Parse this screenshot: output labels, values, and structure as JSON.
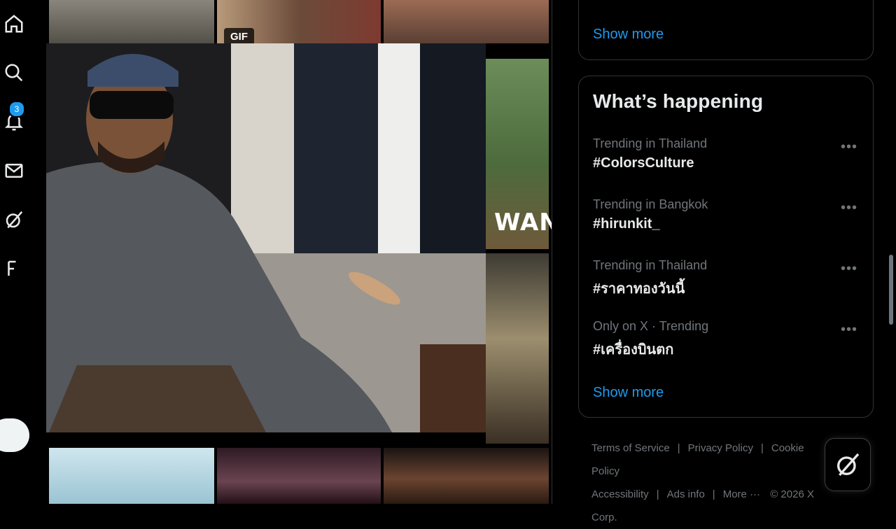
{
  "nav": {
    "notifications_badge": "3",
    "icons": [
      "home-icon",
      "search-icon",
      "bell-icon",
      "mail-icon",
      "grok-icon",
      "people-icon"
    ]
  },
  "grid": {
    "gif_badge": "GIF",
    "overlay_text": "WAN"
  },
  "sidebar": {
    "top_panel": {
      "show_more": "Show more"
    },
    "whats_happening": {
      "title": "What’s happening",
      "trends": [
        {
          "meta": "Trending in Thailand",
          "name": "#ColorsCulture"
        },
        {
          "meta": "Trending in Bangkok",
          "name": "#hirunkit_"
        },
        {
          "meta": "Trending in Thailand",
          "name": "#ราคาทองวันนี้"
        },
        {
          "meta": "Only on X · Trending",
          "name": "#เครื่องบินตก"
        }
      ],
      "show_more": "Show more"
    },
    "footer": {
      "terms": "Terms of Service",
      "privacy": "Privacy Policy",
      "cookie": "Cookie Policy",
      "accessibility": "Accessibility",
      "ads": "Ads info",
      "more": "More ···",
      "copyright": "© 2026 X Corp."
    }
  },
  "colors": {
    "accent": "#1d9bf0",
    "muted": "#71767b",
    "border": "#2f3336",
    "background": "#000000"
  }
}
